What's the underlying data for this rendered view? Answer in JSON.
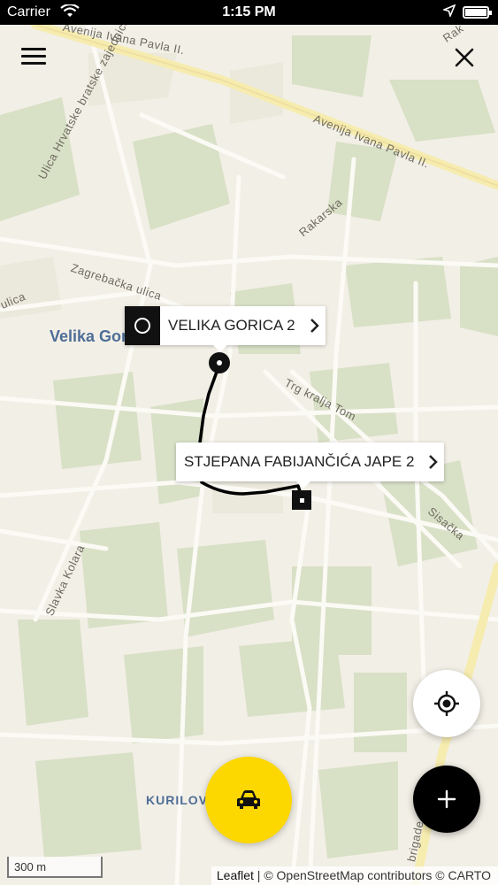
{
  "status_bar": {
    "carrier": "Carrier",
    "time": "1:15 PM"
  },
  "map": {
    "city": "Velika Gorica",
    "district": "KURILOV",
    "streets": {
      "avenija_1": "Avenija Ivana Pavla II.",
      "avenija_2": "Avenija Ivana Pavla II.",
      "hrvatske": "Ulica Hrvatske bratske zajednice",
      "rakarska": "Rakarska",
      "zagrebacka": "Zagrebačka ulica",
      "ulica": "ulica",
      "trg": "Trg kralja Tom",
      "sisacka": "Sisačka",
      "slavka": "Slavka Kolara",
      "brigade": "brigade",
      "rak": "Rak"
    },
    "route_color": "#000000"
  },
  "route": {
    "origin": {
      "label": "VELIKA GORICA 2",
      "icon": "circle-origin-icon"
    },
    "destination": {
      "label": "STJEPANA FABIJANČIĆA JAPE 2",
      "icon": "square-destination-icon"
    }
  },
  "buttons": {
    "menu_icon": "hamburger-menu-icon",
    "close_icon": "close-icon",
    "locate_icon": "crosshair-location-icon",
    "add_icon": "plus-icon",
    "car_icon": "car-icon"
  },
  "colors": {
    "accent_yellow": "#fdd700",
    "dark": "#000000",
    "map_bg": "#f2efe6",
    "label_blue": "#4e6e98"
  },
  "scale": "300 m",
  "attribution": {
    "leaflet": "Leaflet",
    "rest": " | © OpenStreetMap contributors © CARTO"
  }
}
